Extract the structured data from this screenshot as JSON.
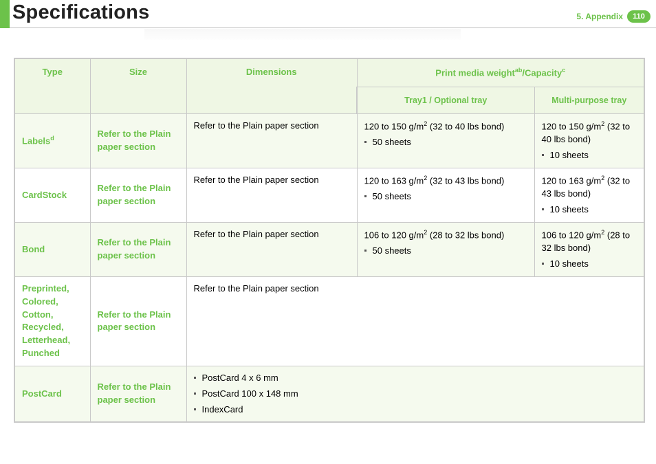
{
  "header": {
    "title": "Specifications",
    "chapter": "5.  Appendix",
    "page": "110"
  },
  "table": {
    "headers": {
      "type": "Type",
      "size": "Size",
      "dimensions": "Dimensions",
      "weight_cap": {
        "prefix": "Print media weight",
        "sup1": "ab",
        "mid": "/Capacity",
        "sup2": "c"
      },
      "tray1": "Tray1 / Optional tray",
      "multi": "Multi-purpose tray"
    },
    "rows": [
      {
        "type": {
          "text": "Labels",
          "sup": "d"
        },
        "size": "Refer to the Plain paper section",
        "dimensions": "Refer to the Plain paper section",
        "tray1": {
          "range_pre": "120 to 150 g/m",
          "sup": "2",
          "range_post": " (32 to 40 lbs bond)",
          "capacity": "50 sheets"
        },
        "multi": {
          "range_pre": "120 to 150 g/m",
          "sup": "2",
          "range_post": " (32 to 40 lbs bond)",
          "capacity": "10 sheets"
        }
      },
      {
        "type": {
          "text": "CardStock"
        },
        "size": "Refer to the Plain paper section",
        "dimensions": "Refer to the Plain paper section",
        "tray1": {
          "range_pre": "120 to 163 g/m",
          "sup": "2",
          "range_post": " (32 to 43 lbs bond)",
          "capacity": "50 sheets"
        },
        "multi": {
          "range_pre": "120 to 163 g/m",
          "sup": "2",
          "range_post": " (32 to 43 lbs bond)",
          "capacity": "10 sheets"
        }
      },
      {
        "type": {
          "text": "Bond"
        },
        "size": "Refer to the Plain paper section",
        "dimensions": "Refer to the Plain paper section",
        "tray1": {
          "range_pre": "106 to 120 g/m",
          "sup": "2",
          "range_post": " (28 to 32 lbs bond)",
          "capacity": "50 sheets"
        },
        "multi": {
          "range_pre": "106 to 120 g/m",
          "sup": "2",
          "range_post": " (28 to 32 lbs bond)",
          "capacity": "10 sheets"
        }
      },
      {
        "type": {
          "lines": [
            "Preprinted,",
            "Colored,",
            "Cotton,",
            "Recycled,",
            "Letterhead,",
            "Punched"
          ]
        },
        "size": "Refer to the Plain paper section",
        "dimensions": "Refer to the Plain paper section"
      },
      {
        "type": {
          "text": "PostCard"
        },
        "size": "Refer to the Plain paper section",
        "dimensions_list": [
          "PostCard 4 x 6 mm",
          "PostCard 100 x 148 mm",
          "IndexCard"
        ]
      }
    ]
  }
}
